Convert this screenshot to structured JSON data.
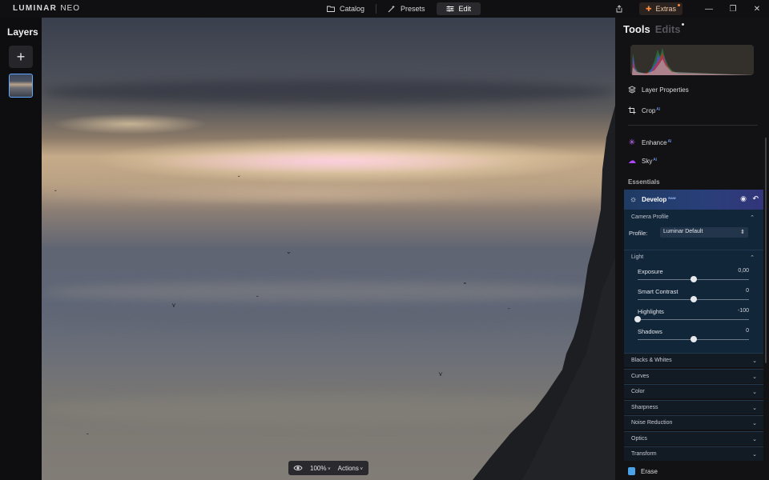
{
  "app": {
    "logo_main": "LUMINAR",
    "logo_suffix": "NEO"
  },
  "titlebar": {
    "modes": [
      {
        "label": "Catalog",
        "icon": "folder-icon"
      },
      {
        "label": "Presets",
        "icon": "magic-wand-icon"
      },
      {
        "label": "Edit",
        "icon": "sliders-icon"
      }
    ],
    "active_mode": "Edit",
    "extras_label": "Extras"
  },
  "layers": {
    "title": "Layers"
  },
  "canvas": {
    "zoom": "100%",
    "actions": "Actions"
  },
  "panel": {
    "tab_tools": "Tools",
    "tab_edits": "Edits",
    "tools": [
      {
        "label": "Layer Properties",
        "ai": ""
      },
      {
        "label": "Crop",
        "ai": "AI"
      },
      {
        "label": "Enhance",
        "ai": "AI"
      },
      {
        "label": "Sky",
        "ai": "AI"
      }
    ],
    "section_title": "Essentials",
    "develop": {
      "title": "Develop",
      "badge": "RAW",
      "camera_profile": "Camera Profile",
      "profile_label": "Profile:",
      "profile_value": "Luminar Default",
      "light_label": "Light",
      "sliders": [
        {
          "label": "Exposure",
          "value": "0,00",
          "fraction": 0.5
        },
        {
          "label": "Smart Contrast",
          "value": "0",
          "fraction": 0.5
        },
        {
          "label": "Highlights",
          "value": "-100",
          "fraction": 0.0
        },
        {
          "label": "Shadows",
          "value": "0",
          "fraction": 0.5
        }
      ]
    },
    "accordions": [
      "Blacks & Whites",
      "Curves",
      "Color",
      "Sharpness",
      "Noise Reduction",
      "Optics",
      "Transform"
    ],
    "erase": "Erase"
  },
  "colors": {
    "accent": "#5ea8ff",
    "develop_header": "#2a3f7a",
    "extras_accent": "#ff8a3d"
  }
}
